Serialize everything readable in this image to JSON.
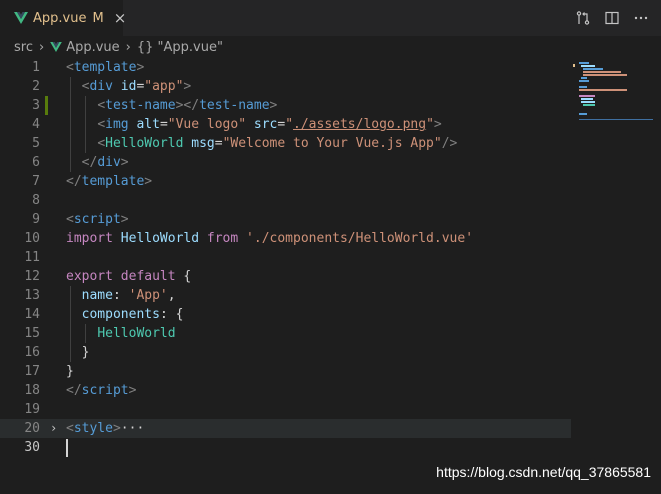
{
  "tab": {
    "filename": "App.vue",
    "status": "M",
    "close": "×"
  },
  "breadcrumb": {
    "folder": "src",
    "file": "App.vue",
    "symbol": "{} \"App.vue\""
  },
  "editor": {
    "lines": [
      {
        "n": "1",
        "tokens": [
          [
            "t-punc",
            "<"
          ],
          [
            "t-tag",
            "template"
          ],
          [
            "t-punc",
            ">"
          ]
        ]
      },
      {
        "n": "2",
        "tokens": [
          [
            "t-plain",
            "  "
          ],
          [
            "t-punc",
            "<"
          ],
          [
            "t-tag",
            "div"
          ],
          [
            "t-plain",
            " "
          ],
          [
            "t-attr",
            "id"
          ],
          [
            "t-plain",
            "="
          ],
          [
            "t-str",
            "\"app\""
          ],
          [
            "t-punc",
            ">"
          ]
        ]
      },
      {
        "n": "3",
        "tokens": [
          [
            "t-plain",
            "    "
          ],
          [
            "t-punc",
            "<"
          ],
          [
            "t-tag",
            "test-name"
          ],
          [
            "t-punc",
            "></"
          ],
          [
            "t-tag",
            "test-name"
          ],
          [
            "t-punc",
            ">"
          ]
        ],
        "modified": true
      },
      {
        "n": "4",
        "tokens": [
          [
            "t-plain",
            "    "
          ],
          [
            "t-punc",
            "<"
          ],
          [
            "t-tag",
            "img"
          ],
          [
            "t-plain",
            " "
          ],
          [
            "t-attr",
            "alt"
          ],
          [
            "t-plain",
            "="
          ],
          [
            "t-str",
            "\"Vue logo\""
          ],
          [
            "t-plain",
            " "
          ],
          [
            "t-attr",
            "src"
          ],
          [
            "t-plain",
            "="
          ],
          [
            "t-str",
            "\""
          ],
          [
            "t-link",
            "./assets/logo.png"
          ],
          [
            "t-str",
            "\""
          ],
          [
            "t-punc",
            ">"
          ]
        ]
      },
      {
        "n": "5",
        "tokens": [
          [
            "t-plain",
            "    "
          ],
          [
            "t-punc",
            "<"
          ],
          [
            "t-cls",
            "HelloWorld"
          ],
          [
            "t-plain",
            " "
          ],
          [
            "t-attr",
            "msg"
          ],
          [
            "t-plain",
            "="
          ],
          [
            "t-str",
            "\"Welcome to Your Vue.js App\""
          ],
          [
            "t-punc",
            "/>"
          ]
        ]
      },
      {
        "n": "6",
        "tokens": [
          [
            "t-plain",
            "  "
          ],
          [
            "t-punc",
            "</"
          ],
          [
            "t-tag",
            "div"
          ],
          [
            "t-punc",
            ">"
          ]
        ]
      },
      {
        "n": "7",
        "tokens": [
          [
            "t-punc",
            "</"
          ],
          [
            "t-tag",
            "template"
          ],
          [
            "t-punc",
            ">"
          ]
        ]
      },
      {
        "n": "8",
        "tokens": []
      },
      {
        "n": "9",
        "tokens": [
          [
            "t-punc",
            "<"
          ],
          [
            "t-tag",
            "script"
          ],
          [
            "t-punc",
            ">"
          ]
        ]
      },
      {
        "n": "10",
        "tokens": [
          [
            "t-kw",
            "import"
          ],
          [
            "t-plain",
            " "
          ],
          [
            "t-attr",
            "HelloWorld"
          ],
          [
            "t-plain",
            " "
          ],
          [
            "t-kw",
            "from"
          ],
          [
            "t-plain",
            " "
          ],
          [
            "t-str",
            "'./components/HelloWorld.vue'"
          ]
        ]
      },
      {
        "n": "11",
        "tokens": []
      },
      {
        "n": "12",
        "tokens": [
          [
            "t-kw",
            "export"
          ],
          [
            "t-plain",
            " "
          ],
          [
            "t-kw",
            "default"
          ],
          [
            "t-plain",
            " {"
          ]
        ]
      },
      {
        "n": "13",
        "tokens": [
          [
            "t-plain",
            "  "
          ],
          [
            "t-attr",
            "name"
          ],
          [
            "t-plain",
            ": "
          ],
          [
            "t-str",
            "'App'"
          ],
          [
            "t-plain",
            ","
          ]
        ]
      },
      {
        "n": "14",
        "tokens": [
          [
            "t-plain",
            "  "
          ],
          [
            "t-attr",
            "components"
          ],
          [
            "t-plain",
            ": {"
          ]
        ]
      },
      {
        "n": "15",
        "tokens": [
          [
            "t-plain",
            "    "
          ],
          [
            "t-cls",
            "HelloWorld"
          ]
        ]
      },
      {
        "n": "16",
        "tokens": [
          [
            "t-plain",
            "  }"
          ]
        ]
      },
      {
        "n": "17",
        "tokens": [
          [
            "t-plain",
            "}"
          ]
        ]
      },
      {
        "n": "18",
        "tokens": [
          [
            "t-punc",
            "</"
          ],
          [
            "t-tag",
            "script"
          ],
          [
            "t-punc",
            ">"
          ]
        ]
      },
      {
        "n": "19",
        "tokens": []
      },
      {
        "n": "20",
        "tokens": [
          [
            "t-punc",
            "<"
          ],
          [
            "t-tag",
            "style"
          ],
          [
            "t-punc",
            ">"
          ],
          [
            "t-plain",
            "···"
          ]
        ],
        "folded": true
      },
      {
        "n": "30",
        "tokens": [],
        "current": true
      }
    ]
  },
  "watermark": "https://blog.csdn.net/qq_37865581",
  "colors": {
    "vue_green": "#41b883",
    "vue_dark": "#35495e",
    "modified": "#e2c08d"
  }
}
